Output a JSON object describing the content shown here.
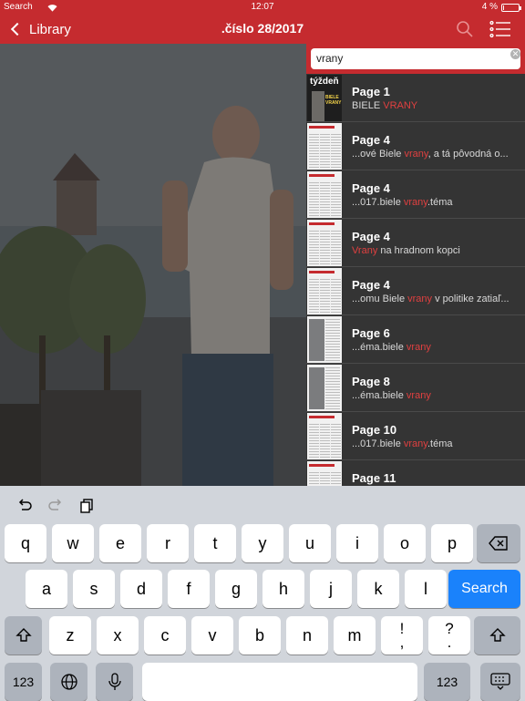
{
  "status_bar": {
    "carrier": "Search",
    "time": "12:07",
    "battery": "4 %",
    "battery_level": 0.04
  },
  "nav": {
    "back_label": "Library",
    "title": ".číslo 28/2017"
  },
  "search": {
    "query": "vrany"
  },
  "results": [
    {
      "page": "Page 1",
      "pre": "BIELE ",
      "hit": "VRANY",
      "post": ""
    },
    {
      "page": "Page 4",
      "pre": "...ové Biele ",
      "hit": "vrany",
      "post": ", a tá pôvodná o..."
    },
    {
      "page": "Page 4",
      "pre": "...017.biele ",
      "hit": "vrany",
      "post": ".téma"
    },
    {
      "page": "Page 4",
      "pre": "",
      "hit": "Vrany",
      "post": " na hradnom kopci"
    },
    {
      "page": "Page 4",
      "pre": "...omu Biele ",
      "hit": "vrany",
      "post": " v politike zatiaľ..."
    },
    {
      "page": "Page 6",
      "pre": "...éma.biele ",
      "hit": "vrany",
      "post": ""
    },
    {
      "page": "Page 8",
      "pre": "...éma.biele ",
      "hit": "vrany",
      "post": ""
    },
    {
      "page": "Page 10",
      "pre": "...017.biele ",
      "hit": "vrany",
      "post": ".téma"
    },
    {
      "page": "Page 11",
      "pre": "",
      "hit": "",
      "post": ""
    }
  ],
  "cover": {
    "masthead": "týždeň",
    "headline": "BIELE VRANY"
  },
  "keyboard": {
    "row1": [
      "q",
      "w",
      "e",
      "r",
      "t",
      "y",
      "u",
      "i",
      "o",
      "p"
    ],
    "row2": [
      "a",
      "s",
      "d",
      "f",
      "g",
      "h",
      "j",
      "k",
      "l"
    ],
    "row3": [
      "z",
      "x",
      "c",
      "v",
      "b",
      "n",
      "m",
      "!\n,",
      "?\n."
    ],
    "search_label": "Search",
    "numbers_label": "123"
  },
  "colors": {
    "brand_red": "#c52b2f",
    "highlight": "#e04040",
    "key_blue": "#1a82fb"
  }
}
